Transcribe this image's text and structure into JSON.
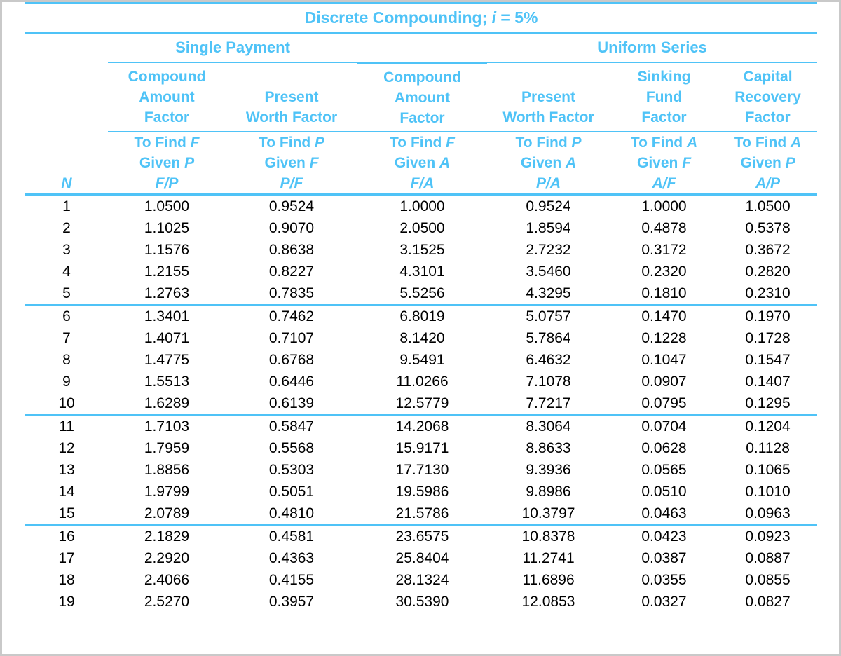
{
  "title": {
    "prefix": "Discrete Compounding; ",
    "symbol": "i",
    "suffix": " = 5%"
  },
  "groups": {
    "single_payment": "Single Payment",
    "uniform_series": "Uniform Series"
  },
  "columns": [
    {
      "key": "N",
      "name_lines": [],
      "to_find": "",
      "given": "",
      "ratio": "N"
    },
    {
      "key": "FP",
      "name_lines": [
        "Compound",
        "Amount",
        "Factor"
      ],
      "to_find_prefix": "To Find ",
      "to_find_var": "F",
      "given_prefix": "Given ",
      "given_var": "P",
      "ratio": "F/P"
    },
    {
      "key": "PF",
      "name_lines": [
        "Present",
        "Worth Factor"
      ],
      "to_find_prefix": "To Find ",
      "to_find_var": "P",
      "given_prefix": "Given ",
      "given_var": "F",
      "ratio": "P/F"
    },
    {
      "key": "FA",
      "name_lines": [
        "Compound",
        "Amount",
        "Factor"
      ],
      "to_find_prefix": "To Find ",
      "to_find_var": "F",
      "given_prefix": "Given ",
      "given_var": "A",
      "ratio": "F/A"
    },
    {
      "key": "PA",
      "name_lines": [
        "Present",
        "Worth Factor"
      ],
      "to_find_prefix": "To Find ",
      "to_find_var": "P",
      "given_prefix": "Given ",
      "given_var": "A",
      "ratio": "P/A"
    },
    {
      "key": "AF",
      "name_lines": [
        "Sinking",
        "Fund",
        "Factor"
      ],
      "to_find_prefix": "To Find ",
      "to_find_var": "A",
      "given_prefix": "Given ",
      "given_var": "F",
      "ratio": "A/F"
    },
    {
      "key": "AP",
      "name_lines": [
        "Capital",
        "Recovery",
        "Factor"
      ],
      "to_find_prefix": "To Find ",
      "to_find_var": "A",
      "given_prefix": "Given ",
      "given_var": "P",
      "ratio": "A/P"
    }
  ],
  "rows": [
    {
      "N": "1",
      "FP": "1.0500",
      "PF": "0.9524",
      "FA": "1.0000",
      "PA": "0.9524",
      "AF": "1.0000",
      "AP": "1.0500"
    },
    {
      "N": "2",
      "FP": "1.1025",
      "PF": "0.9070",
      "FA": "2.0500",
      "PA": "1.8594",
      "AF": "0.4878",
      "AP": "0.5378"
    },
    {
      "N": "3",
      "FP": "1.1576",
      "PF": "0.8638",
      "FA": "3.1525",
      "PA": "2.7232",
      "AF": "0.3172",
      "AP": "0.3672"
    },
    {
      "N": "4",
      "FP": "1.2155",
      "PF": "0.8227",
      "FA": "4.3101",
      "PA": "3.5460",
      "AF": "0.2320",
      "AP": "0.2820"
    },
    {
      "N": "5",
      "FP": "1.2763",
      "PF": "0.7835",
      "FA": "5.5256",
      "PA": "4.3295",
      "AF": "0.1810",
      "AP": "0.2310"
    },
    {
      "N": "6",
      "FP": "1.3401",
      "PF": "0.7462",
      "FA": "6.8019",
      "PA": "5.0757",
      "AF": "0.1470",
      "AP": "0.1970"
    },
    {
      "N": "7",
      "FP": "1.4071",
      "PF": "0.7107",
      "FA": "8.1420",
      "PA": "5.7864",
      "AF": "0.1228",
      "AP": "0.1728"
    },
    {
      "N": "8",
      "FP": "1.4775",
      "PF": "0.6768",
      "FA": "9.5491",
      "PA": "6.4632",
      "AF": "0.1047",
      "AP": "0.1547"
    },
    {
      "N": "9",
      "FP": "1.5513",
      "PF": "0.6446",
      "FA": "11.0266",
      "PA": "7.1078",
      "AF": "0.0907",
      "AP": "0.1407"
    },
    {
      "N": "10",
      "FP": "1.6289",
      "PF": "0.6139",
      "FA": "12.5779",
      "PA": "7.7217",
      "AF": "0.0795",
      "AP": "0.1295"
    },
    {
      "N": "11",
      "FP": "1.7103",
      "PF": "0.5847",
      "FA": "14.2068",
      "PA": "8.3064",
      "AF": "0.0704",
      "AP": "0.1204"
    },
    {
      "N": "12",
      "FP": "1.7959",
      "PF": "0.5568",
      "FA": "15.9171",
      "PA": "8.8633",
      "AF": "0.0628",
      "AP": "0.1128"
    },
    {
      "N": "13",
      "FP": "1.8856",
      "PF": "0.5303",
      "FA": "17.7130",
      "PA": "9.3936",
      "AF": "0.0565",
      "AP": "0.1065"
    },
    {
      "N": "14",
      "FP": "1.9799",
      "PF": "0.5051",
      "FA": "19.5986",
      "PA": "9.8986",
      "AF": "0.0510",
      "AP": "0.1010"
    },
    {
      "N": "15",
      "FP": "2.0789",
      "PF": "0.4810",
      "FA": "21.5786",
      "PA": "10.3797",
      "AF": "0.0463",
      "AP": "0.0963"
    },
    {
      "N": "16",
      "FP": "2.1829",
      "PF": "0.4581",
      "FA": "23.6575",
      "PA": "10.8378",
      "AF": "0.0423",
      "AP": "0.0923"
    },
    {
      "N": "17",
      "FP": "2.2920",
      "PF": "0.4363",
      "FA": "25.8404",
      "PA": "11.2741",
      "AF": "0.0387",
      "AP": "0.0887"
    },
    {
      "N": "18",
      "FP": "2.4066",
      "PF": "0.4155",
      "FA": "28.1324",
      "PA": "11.6896",
      "AF": "0.0355",
      "AP": "0.0855"
    },
    {
      "N": "19",
      "FP": "2.5270",
      "PF": "0.3957",
      "FA": "30.5390",
      "PA": "12.0853",
      "AF": "0.0327",
      "AP": "0.0827"
    }
  ],
  "group_separator_after_rows": [
    5,
    10,
    15
  ],
  "colors": {
    "accent": "#4FC3F7",
    "text": "#000000",
    "background": "#FFFFFF",
    "border": "#C9C9C9"
  }
}
